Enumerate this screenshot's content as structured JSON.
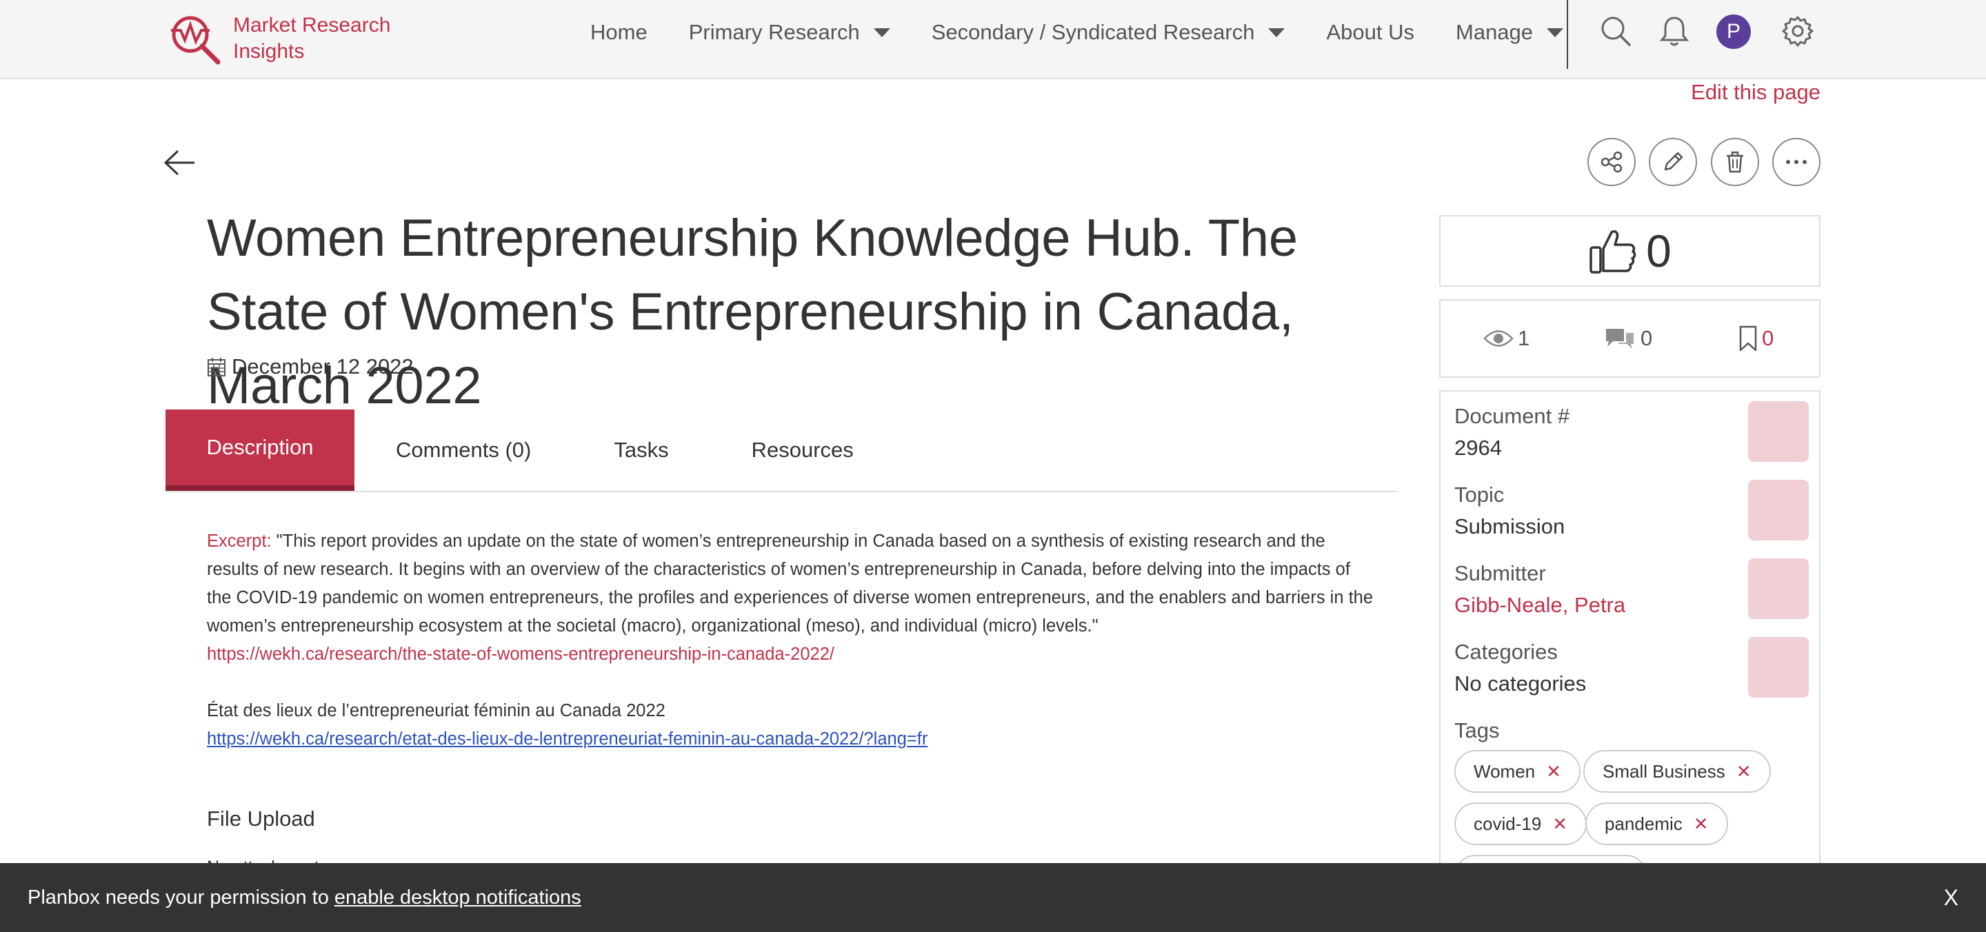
{
  "brand": {
    "line1": "Market Research",
    "line2": "Insights"
  },
  "nav": {
    "home": "Home",
    "primary": "Primary Research",
    "secondary": "Secondary / Syndicated Research",
    "about": "About Us",
    "manage": "Manage"
  },
  "user": {
    "initial": "P"
  },
  "edit_link": "Edit this page",
  "page": {
    "title": "Women Entrepreneurship Knowledge Hub. The State of Women's Entrepreneurship in Canada, March 2022",
    "date": "December 12 2022"
  },
  "tabs": [
    "Description",
    "Comments (0)",
    "Tasks",
    "Resources"
  ],
  "description": {
    "excerpt_label": "Excerpt:",
    "excerpt_text": " \"This report provides an update on the state of women’s entrepreneurship in Canada based on a synthesis of existing research and the results of new research. It begins with an overview of the characteristics of women’s entrepreneurship in Canada, before delving into the impacts of the COVID-19 pandemic on women entrepreneurs, the profiles and experiences of diverse women entrepreneurs, and the enablers and barriers in the women’s entrepreneurship ecosystem at the societal (macro), organizational (meso), and individual (micro) levels.\"",
    "link_en": "https://wekh.ca/research/the-state-of-womens-entrepreneurship-in-canada-2022/",
    "french_title": "État des lieux de l’entrepreneuriat féminin au Canada 2022",
    "link_fr": "https://wekh.ca/research/etat-des-lieux-de-lentrepreneuriat-feminin-au-canada-2022/?lang=fr",
    "file_upload_label": "File Upload",
    "no_attachments": "No attachments"
  },
  "stats": {
    "likes": "0",
    "views": "1",
    "comments": "0",
    "bookmarks": "0"
  },
  "meta": {
    "document_label": "Document #",
    "document_value": "2964",
    "topic_label": "Topic",
    "topic_value": "Submission",
    "submitter_label": "Submitter",
    "submitter_value": "Gibb-Neale, Petra",
    "categories_label": "Categories",
    "categories_value": "No categories",
    "tags_label": "Tags",
    "tags": [
      "Women",
      "Small Business",
      "covid-19",
      "pandemic"
    ]
  },
  "notification": {
    "text": "Planbox needs your permission to",
    "link": "enable desktop notifications",
    "close": "X"
  },
  "colors": {
    "accent": "#c0334a",
    "avatar": "#5b3e9a",
    "notify_bg": "#333333"
  }
}
